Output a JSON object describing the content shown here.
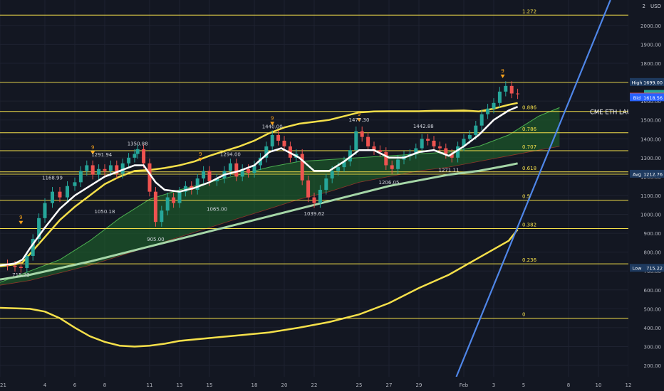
{
  "chart_data": {
    "type": "candlestick",
    "currency": "USD",
    "currency_multiplier": "2",
    "y_range": [
      140,
      2135
    ],
    "x_range": [
      0,
      42
    ],
    "y_ticks": [
      200,
      300,
      400,
      500,
      600,
      700,
      800,
      900,
      1000,
      1100,
      1200,
      1300,
      1400,
      1500,
      1600,
      1700,
      1800,
      1900,
      2000
    ],
    "y_tick_labels": [
      "200.00",
      "300.00",
      "400.00",
      "500.00",
      "600.00",
      "700.00",
      "800.00",
      "900.00",
      "1000.00",
      "1100.00",
      "1200.00",
      "1300.00",
      "1400.00",
      "1500.00",
      "1600.00",
      "1700.00",
      "1800.00",
      "1900.00",
      "2000.00"
    ],
    "x_ticks": [
      {
        "t": 0,
        "label": "2021"
      },
      {
        "t": 3,
        "label": "4"
      },
      {
        "t": 5,
        "label": "6"
      },
      {
        "t": 7,
        "label": "8"
      },
      {
        "t": 10,
        "label": "11"
      },
      {
        "t": 12,
        "label": "13"
      },
      {
        "t": 14,
        "label": "15"
      },
      {
        "t": 17,
        "label": "18"
      },
      {
        "t": 19,
        "label": "20"
      },
      {
        "t": 21,
        "label": "22"
      },
      {
        "t": 24,
        "label": "25"
      },
      {
        "t": 26,
        "label": "27"
      },
      {
        "t": 28,
        "label": "29"
      },
      {
        "t": 31,
        "label": "Feb"
      },
      {
        "t": 33,
        "label": "3"
      },
      {
        "t": 35,
        "label": "5"
      },
      {
        "t": 38,
        "label": "8"
      },
      {
        "t": 40,
        "label": "10"
      },
      {
        "t": 42,
        "label": "12"
      }
    ],
    "fib_levels": [
      {
        "label": "1.272",
        "value": 2055
      },
      {
        "label": "0.886",
        "value": 1545
      },
      {
        "label": "0.786",
        "value": 1432
      },
      {
        "label": "0.707",
        "value": 1337
      },
      {
        "label": "0.618",
        "value": 1225
      },
      {
        "label": "0.5",
        "value": 1075
      },
      {
        "label": "0.382",
        "value": 925
      },
      {
        "label": "0.236",
        "value": 738
      },
      {
        "label": "0",
        "value": 450
      }
    ],
    "peak_labels": [
      {
        "label": "715.22",
        "t": 1.4,
        "value": 715
      },
      {
        "label": "1168.99",
        "t": 3.5,
        "value": 1169
      },
      {
        "label": "1291.94",
        "t": 6.8,
        "value": 1292
      },
      {
        "label": "1050.18",
        "t": 7.0,
        "value": 1050
      },
      {
        "label": "1350.88",
        "t": 9.2,
        "value": 1351
      },
      {
        "label": "905.00",
        "t": 10.4,
        "value": 905
      },
      {
        "label": "1065.00",
        "t": 14.5,
        "value": 1065
      },
      {
        "label": "1294.00",
        "t": 15.4,
        "value": 1294
      },
      {
        "label": "1440.00",
        "t": 18.2,
        "value": 1440
      },
      {
        "label": "1039.62",
        "t": 21.0,
        "value": 1040
      },
      {
        "label": "1477.30",
        "t": 24.0,
        "value": 1477
      },
      {
        "label": "1206.05",
        "t": 26.0,
        "value": 1206
      },
      {
        "label": "1442.88",
        "t": 28.3,
        "value": 1443
      },
      {
        "label": "1271.11",
        "t": 30.0,
        "value": 1271
      }
    ],
    "price_flags": [
      {
        "label": "High",
        "value_text": "1699.00",
        "value": 1699,
        "color": "#1e3a5f"
      },
      {
        "label": "",
        "value_text": "1636.48",
        "value": 1636,
        "color": "#26a69a"
      },
      {
        "label": "Ask",
        "value_text": "1621.71",
        "value": 1621,
        "color": "#ef5350"
      },
      {
        "label": "",
        "value_text": "1621.66",
        "value": 1620,
        "color": "#ef5350"
      },
      {
        "label": "Bid",
        "value_text": "1618.56",
        "value": 1618,
        "color": "#2962ff"
      },
      {
        "label": "Avg",
        "value_text": "1212.76",
        "value": 1213,
        "color": "#1e3a5f"
      },
      {
        "label": "Low",
        "value_text": "715.22",
        "value": 715,
        "color": "#1e3a5f"
      }
    ],
    "hlines": [
      {
        "value": 1699,
        "color": "#f5e04a"
      },
      {
        "value": 1213,
        "color": "#f5e04a"
      }
    ],
    "annotation": "CME ETH LAUNCH",
    "seq_nine_marks": [
      {
        "t": 1.4,
        "value": 950
      },
      {
        "t": 6.2,
        "value": 1320
      },
      {
        "t": 13.4,
        "value": 1285
      },
      {
        "t": 18.2,
        "value": 1475
      },
      {
        "t": 24.0,
        "value": 1495
      },
      {
        "t": 33.6,
        "value": 1725
      }
    ],
    "price_path": [
      [
        0,
        735
      ],
      [
        0.5,
        728
      ],
      [
        1,
        722
      ],
      [
        1.4,
        716
      ],
      [
        1.8,
        780
      ],
      [
        2.2,
        870
      ],
      [
        2.6,
        980
      ],
      [
        3,
        1060
      ],
      [
        3.5,
        1120
      ],
      [
        4,
        1090
      ],
      [
        4.5,
        1150
      ],
      [
        5,
        1170
      ],
      [
        5.4,
        1230
      ],
      [
        5.8,
        1260
      ],
      [
        6.2,
        1210
      ],
      [
        6.6,
        1240
      ],
      [
        7,
        1230
      ],
      [
        7.4,
        1260
      ],
      [
        7.8,
        1215
      ],
      [
        8.2,
        1270
      ],
      [
        8.6,
        1300
      ],
      [
        9,
        1320
      ],
      [
        9.2,
        1345
      ],
      [
        9.6,
        1270
      ],
      [
        10,
        1120
      ],
      [
        10.4,
        960
      ],
      [
        10.8,
        1020
      ],
      [
        11.2,
        1090
      ],
      [
        11.6,
        1060
      ],
      [
        12,
        1120
      ],
      [
        12.4,
        1150
      ],
      [
        12.8,
        1130
      ],
      [
        13.2,
        1190
      ],
      [
        13.6,
        1230
      ],
      [
        14,
        1175
      ],
      [
        14.5,
        1190
      ],
      [
        15,
        1230
      ],
      [
        15.4,
        1270
      ],
      [
        15.8,
        1200
      ],
      [
        16.2,
        1240
      ],
      [
        16.6,
        1220
      ],
      [
        17,
        1260
      ],
      [
        17.4,
        1300
      ],
      [
        17.8,
        1360
      ],
      [
        18.2,
        1420
      ],
      [
        18.6,
        1390
      ],
      [
        19,
        1360
      ],
      [
        19.4,
        1300
      ],
      [
        19.8,
        1320
      ],
      [
        20.2,
        1180
      ],
      [
        20.6,
        1090
      ],
      [
        21,
        1060
      ],
      [
        21.4,
        1130
      ],
      [
        21.8,
        1190
      ],
      [
        22.2,
        1230
      ],
      [
        22.6,
        1250
      ],
      [
        23,
        1280
      ],
      [
        23.4,
        1340
      ],
      [
        23.8,
        1440
      ],
      [
        24.2,
        1410
      ],
      [
        24.6,
        1360
      ],
      [
        25,
        1340
      ],
      [
        25.4,
        1330
      ],
      [
        25.8,
        1260
      ],
      [
        26.2,
        1240
      ],
      [
        26.6,
        1290
      ],
      [
        27,
        1310
      ],
      [
        27.4,
        1320
      ],
      [
        27.8,
        1350
      ],
      [
        28.2,
        1400
      ],
      [
        28.6,
        1390
      ],
      [
        29,
        1360
      ],
      [
        29.4,
        1350
      ],
      [
        29.8,
        1320
      ],
      [
        30.2,
        1300
      ],
      [
        30.6,
        1360
      ],
      [
        31,
        1400
      ],
      [
        31.4,
        1420
      ],
      [
        31.8,
        1470
      ],
      [
        32.2,
        1530
      ],
      [
        32.6,
        1560
      ],
      [
        33,
        1590
      ],
      [
        33.4,
        1650
      ],
      [
        33.8,
        1680
      ],
      [
        34.2,
        1640
      ],
      [
        34.6,
        1636
      ]
    ],
    "ema_white": [
      [
        0,
        730
      ],
      [
        1,
        740
      ],
      [
        1.5,
        760
      ],
      [
        2,
        820
      ],
      [
        3,
        930
      ],
      [
        4,
        1030
      ],
      [
        5,
        1100
      ],
      [
        6,
        1150
      ],
      [
        7,
        1200
      ],
      [
        8,
        1230
      ],
      [
        9,
        1260
      ],
      [
        9.6,
        1260
      ],
      [
        10.4,
        1170
      ],
      [
        11,
        1130
      ],
      [
        12,
        1120
      ],
      [
        13,
        1140
      ],
      [
        14,
        1170
      ],
      [
        15,
        1210
      ],
      [
        16,
        1230
      ],
      [
        17,
        1260
      ],
      [
        18,
        1330
      ],
      [
        18.8,
        1350
      ],
      [
        20,
        1300
      ],
      [
        21,
        1230
      ],
      [
        22,
        1230
      ],
      [
        23,
        1280
      ],
      [
        24,
        1340
      ],
      [
        25,
        1340
      ],
      [
        26,
        1300
      ],
      [
        27,
        1300
      ],
      [
        28,
        1330
      ],
      [
        29,
        1340
      ],
      [
        30,
        1310
      ],
      [
        31,
        1360
      ],
      [
        32,
        1420
      ],
      [
        33,
        1500
      ],
      [
        34,
        1550
      ],
      [
        34.6,
        1570
      ]
    ],
    "ema_yellow": [
      [
        0,
        725
      ],
      [
        1,
        735
      ],
      [
        1.5,
        745
      ],
      [
        2,
        790
      ],
      [
        3,
        880
      ],
      [
        4,
        970
      ],
      [
        5,
        1040
      ],
      [
        6,
        1100
      ],
      [
        7,
        1160
      ],
      [
        8,
        1200
      ],
      [
        9,
        1230
      ],
      [
        10,
        1235
      ],
      [
        11,
        1245
      ],
      [
        12,
        1260
      ],
      [
        13,
        1280
      ],
      [
        14,
        1310
      ],
      [
        15,
        1335
      ],
      [
        16,
        1360
      ],
      [
        17,
        1390
      ],
      [
        18,
        1430
      ],
      [
        19,
        1460
      ],
      [
        20,
        1480
      ],
      [
        21,
        1490
      ],
      [
        22,
        1500
      ],
      [
        23,
        1520
      ],
      [
        24,
        1540
      ],
      [
        25,
        1545
      ],
      [
        26,
        1546
      ],
      [
        27,
        1546
      ],
      [
        28,
        1546
      ],
      [
        29,
        1548
      ],
      [
        30,
        1548
      ],
      [
        31,
        1550
      ],
      [
        32,
        1545
      ],
      [
        33,
        1560
      ],
      [
        34,
        1580
      ],
      [
        34.6,
        1590
      ]
    ],
    "ma_green": [
      [
        0,
        655
      ],
      [
        2,
        680
      ],
      [
        4,
        715
      ],
      [
        6,
        750
      ],
      [
        8,
        790
      ],
      [
        10,
        830
      ],
      [
        12,
        870
      ],
      [
        14,
        910
      ],
      [
        16,
        950
      ],
      [
        18,
        990
      ],
      [
        20,
        1030
      ],
      [
        22,
        1070
      ],
      [
        24,
        1110
      ],
      [
        26,
        1150
      ],
      [
        28,
        1180
      ],
      [
        30,
        1210
      ],
      [
        32,
        1230
      ],
      [
        34,
        1260
      ],
      [
        34.6,
        1270
      ]
    ],
    "ma_yellow_long": [
      [
        0,
        505
      ],
      [
        2,
        500
      ],
      [
        3,
        485
      ],
      [
        4,
        450
      ],
      [
        5,
        400
      ],
      [
        6,
        355
      ],
      [
        7,
        325
      ],
      [
        8,
        305
      ],
      [
        9,
        300
      ],
      [
        10,
        305
      ],
      [
        11,
        315
      ],
      [
        12,
        330
      ],
      [
        14,
        345
      ],
      [
        16,
        360
      ],
      [
        18,
        375
      ],
      [
        20,
        400
      ],
      [
        22,
        430
      ],
      [
        24,
        470
      ],
      [
        26,
        530
      ],
      [
        28,
        610
      ],
      [
        30,
        680
      ],
      [
        32,
        770
      ],
      [
        34,
        860
      ],
      [
        34.6,
        920
      ]
    ],
    "cloud_upper": [
      [
        0,
        640
      ],
      [
        2,
        700
      ],
      [
        4,
        760
      ],
      [
        6,
        860
      ],
      [
        8,
        980
      ],
      [
        10,
        1080
      ],
      [
        12,
        1130
      ],
      [
        14,
        1170
      ],
      [
        16,
        1210
      ],
      [
        18,
        1250
      ],
      [
        20,
        1280
      ],
      [
        22,
        1290
      ],
      [
        24,
        1300
      ],
      [
        26,
        1310
      ],
      [
        28,
        1320
      ],
      [
        30,
        1330
      ],
      [
        32,
        1360
      ],
      [
        34,
        1420
      ],
      [
        36,
        1520
      ],
      [
        37.4,
        1565
      ]
    ],
    "cloud_lower": [
      [
        0,
        625
      ],
      [
        2,
        650
      ],
      [
        4,
        690
      ],
      [
        6,
        730
      ],
      [
        8,
        780
      ],
      [
        10,
        830
      ],
      [
        12,
        880
      ],
      [
        14,
        930
      ],
      [
        16,
        980
      ],
      [
        18,
        1030
      ],
      [
        20,
        1080
      ],
      [
        22,
        1120
      ],
      [
        24,
        1170
      ],
      [
        26,
        1200
      ],
      [
        28,
        1230
      ],
      [
        30,
        1250
      ],
      [
        32,
        1280
      ],
      [
        34,
        1310
      ],
      [
        36,
        1340
      ],
      [
        37.4,
        1360
      ]
    ],
    "trendline": [
      [
        30.5,
        140
      ],
      [
        40.8,
        2135
      ]
    ]
  }
}
